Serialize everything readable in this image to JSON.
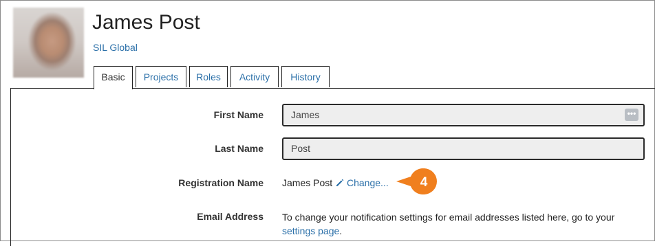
{
  "profile": {
    "name": "James Post",
    "organization": "SIL Global"
  },
  "tabs": [
    {
      "label": "Basic",
      "active": true
    },
    {
      "label": "Projects",
      "active": false
    },
    {
      "label": "Roles",
      "active": false
    },
    {
      "label": "Activity",
      "active": false
    },
    {
      "label": "History",
      "active": false
    }
  ],
  "form": {
    "first_name_label": "First Name",
    "first_name_value": "James",
    "last_name_label": "Last Name",
    "last_name_value": "Post",
    "registration_label": "Registration Name",
    "registration_value": "James Post",
    "change_link": "Change...",
    "email_label": "Email Address",
    "email_text": "To change your notification settings for email addresses listed here, go to your",
    "settings_link": "settings page",
    "email_text_end": "."
  },
  "callout": {
    "number": "4",
    "color": "#f07f1e"
  },
  "colors": {
    "link": "#2a6fa8",
    "field_bg": "#eeeeee"
  }
}
